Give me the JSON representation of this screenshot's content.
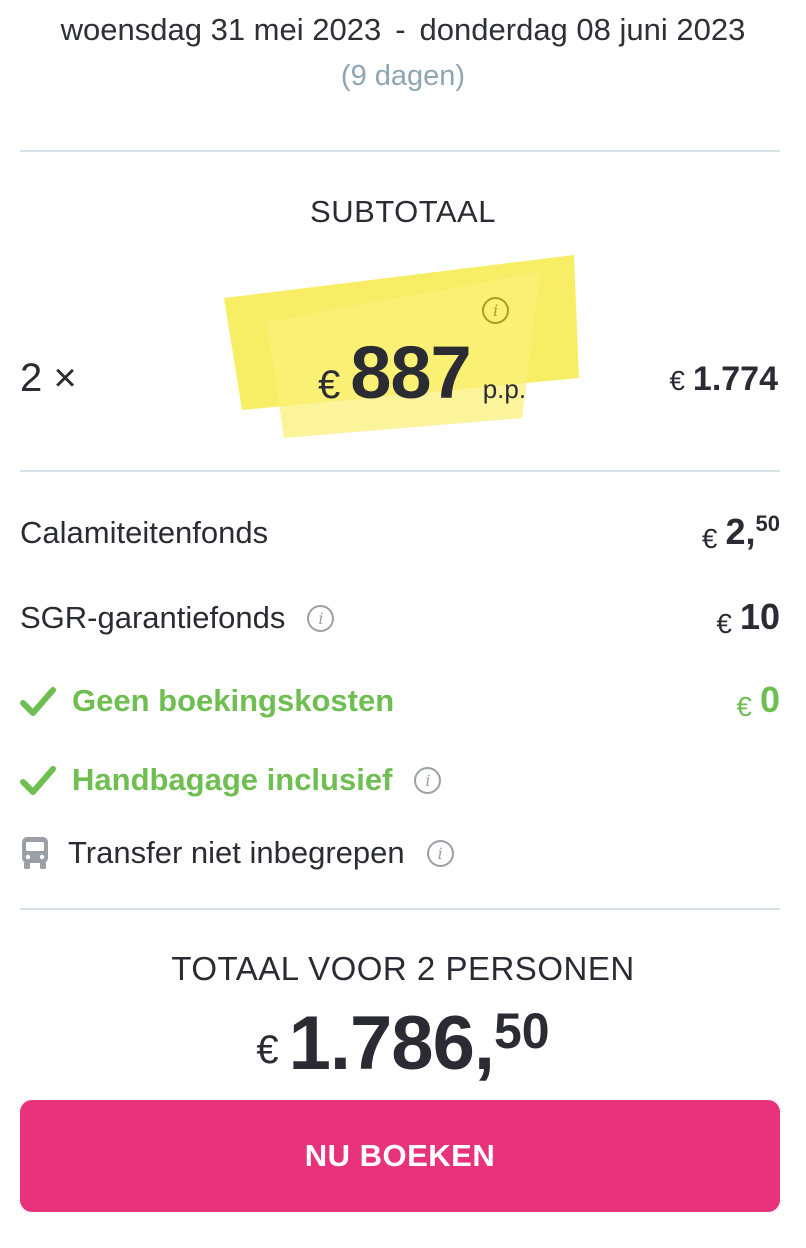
{
  "period": {
    "start_date": "woensdag 31 mei 2023",
    "separator": "-",
    "end_date": "donderdag 08 juni 2023",
    "duration": "(9 dagen)"
  },
  "subtotal": {
    "label": "SUBTOTAAL",
    "quantity": "2 ×",
    "currency": "€",
    "price_per_person": "887",
    "per_person_unit": "p.p.",
    "line_total_currency": "€",
    "line_total": "1.774"
  },
  "fees": [
    {
      "label": "Calamiteitenfonds",
      "currency": "€",
      "value": "2,",
      "cents": "50",
      "has_info": false
    },
    {
      "label": "SGR-garantiefonds",
      "currency": "€",
      "value": "10",
      "cents": "",
      "has_info": true
    }
  ],
  "features": {
    "booking_fee": {
      "label": "Geen boekingskosten",
      "currency": "€",
      "value": "0"
    },
    "hand_luggage": {
      "label": "Handbagage inclusief"
    },
    "transfer": {
      "label": "Transfer niet inbegrepen"
    }
  },
  "total": {
    "label": "TOTAAL VOOR 2 PERSONEN",
    "currency": "€",
    "value": "1.786,",
    "cents": "50"
  },
  "cta": {
    "label": "NU BOEKEN"
  },
  "colors": {
    "accent_pink": "#e8327b",
    "success_green": "#6fbe52",
    "highlight_yellow": "#f7ec55",
    "divider": "#d6e1e6"
  },
  "icons": {
    "info": "info-icon",
    "check": "check-icon",
    "bus": "bus-icon"
  }
}
